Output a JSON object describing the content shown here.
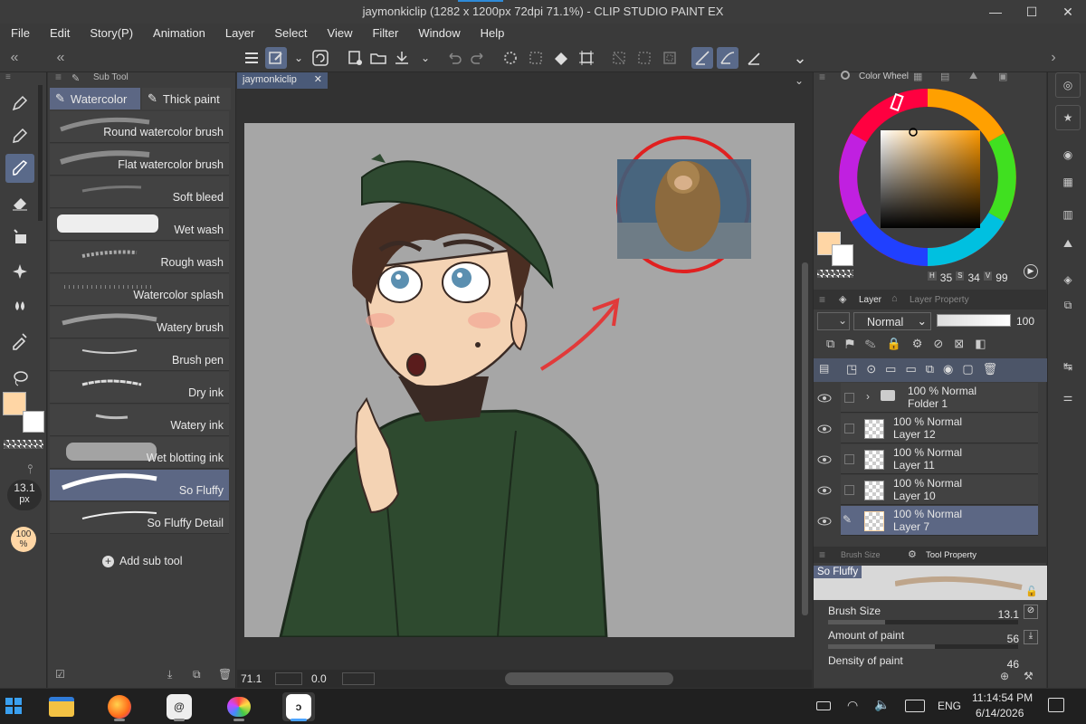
{
  "window": {
    "title": "jaymonkiclip (1282 x 1200px 72dpi 71.1%)  - CLIP STUDIO PAINT EX",
    "minimize": "—",
    "maximize": "☐",
    "close": "✕"
  },
  "menu": [
    "File",
    "Edit",
    "Story(P)",
    "Animation",
    "Layer",
    "Select",
    "View",
    "Filter",
    "Window",
    "Help"
  ],
  "subtool": {
    "panel_title": "Sub Tool",
    "tabs": [
      "Watercolor",
      "Thick paint"
    ],
    "brushes": [
      "Round watercolor brush",
      "Flat watercolor brush",
      "Soft bleed",
      "Wet wash",
      "Rough wash",
      "Watercolor splash",
      "Watery brush",
      "Brush pen",
      "Dry ink",
      "Watery ink",
      "Wet blotting ink",
      "So Fluffy",
      "So Fluffy Detail"
    ],
    "selected_brush": "So Fluffy",
    "add_label": "Add sub tool"
  },
  "tool_column": {
    "size_value": "13.1",
    "size_unit": "px",
    "opacity_value": "100",
    "opacity_unit": "%"
  },
  "document": {
    "tab_name": "jaymonkiclip",
    "zoom": "71.1",
    "rotation": "0.0"
  },
  "color_wheel": {
    "panel_title": "Color Wheel",
    "h_label": "H",
    "h_value": "35",
    "s_label": "S",
    "s_value": "34",
    "v_label": "V",
    "v_value": "99",
    "main_color": "#ffd6a5",
    "sub_color": "#ffffff"
  },
  "layer_panel": {
    "title": "Layer",
    "property_tab": "Layer Property",
    "blend_mode": "Normal",
    "opacity": "100",
    "layers": [
      {
        "opacity_mode": "100 % Normal",
        "name": "Folder 1",
        "type": "folder"
      },
      {
        "opacity_mode": "100 % Normal",
        "name": "Layer 12",
        "type": "raster"
      },
      {
        "opacity_mode": "100 % Normal",
        "name": "Layer 11",
        "type": "raster"
      },
      {
        "opacity_mode": "100 % Normal",
        "name": "Layer 10",
        "type": "raster"
      },
      {
        "opacity_mode": "100 % Normal",
        "name": "Layer 7",
        "type": "raster",
        "selected": true
      }
    ]
  },
  "tool_property": {
    "tab_brush_size": "Brush Size",
    "tab_tool_property": "Tool Property",
    "brush_name": "So Fluffy",
    "brush_size_label": "Brush Size",
    "brush_size_value": "13.1",
    "amount_label": "Amount of paint",
    "amount_value": "56",
    "density_label": "Density of paint",
    "density_value": "46"
  },
  "taskbar": {
    "language": "ENG",
    "time": "11:14:54 PM",
    "date": "6/14/2026"
  }
}
